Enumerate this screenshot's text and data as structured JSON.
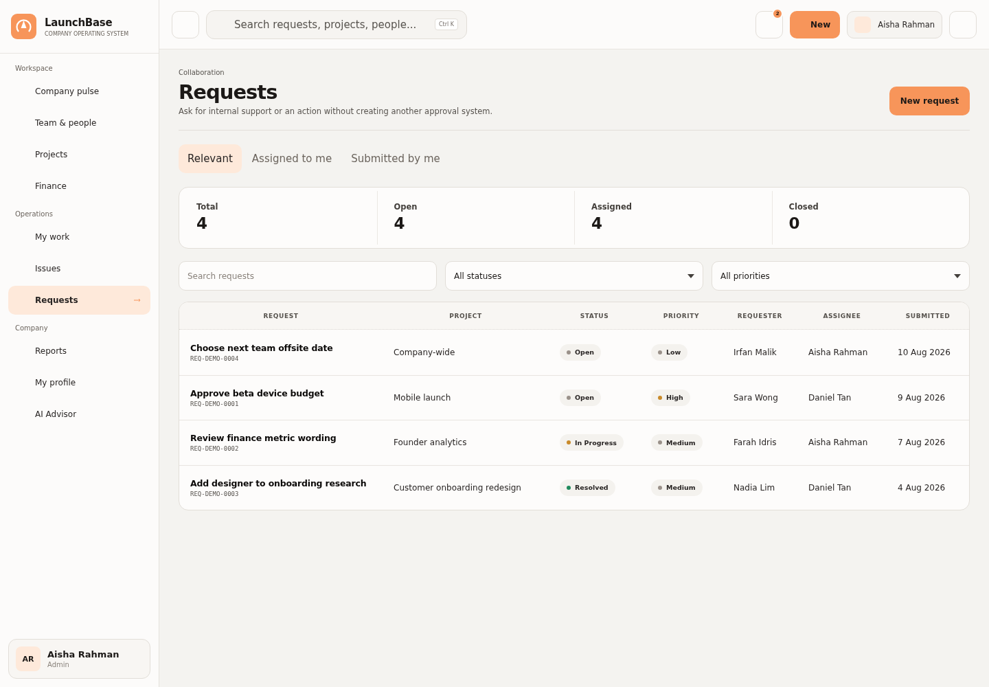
{
  "brand": {
    "name": "LaunchBase",
    "tagline": "COMPANY OPERATING SYSTEM"
  },
  "sidebar": {
    "sections": [
      {
        "title": "Workspace",
        "items": [
          {
            "label": "Company pulse",
            "selected": false
          },
          {
            "label": "Team & people",
            "selected": false
          },
          {
            "label": "Projects",
            "selected": false
          },
          {
            "label": "Finance",
            "selected": false
          }
        ]
      },
      {
        "title": "Operations",
        "items": [
          {
            "label": "My work",
            "selected": false
          },
          {
            "label": "Issues",
            "selected": false
          },
          {
            "label": "Requests",
            "selected": true
          }
        ]
      },
      {
        "title": "Company",
        "items": [
          {
            "label": "Reports",
            "selected": false
          },
          {
            "label": "My profile",
            "selected": false
          },
          {
            "label": "AI Advisor",
            "selected": false
          }
        ]
      }
    ],
    "user": {
      "initials": "AR",
      "name": "Aisha Rahman",
      "role": "Admin"
    }
  },
  "topbar": {
    "search_placeholder": "Search requests, projects, people...",
    "shortcut": "Ctrl K",
    "notification_count": "2",
    "new_button": "New",
    "user_name": "Aisha Rahman"
  },
  "page": {
    "breadcrumb": "Collaboration",
    "title": "Requests",
    "subtitle": "Ask for internal support or an action without creating another approval system.",
    "action": "New request"
  },
  "tabs": [
    {
      "label": "Relevant",
      "selected": true
    },
    {
      "label": "Assigned to me",
      "selected": false
    },
    {
      "label": "Submitted by me",
      "selected": false
    }
  ],
  "stats": [
    {
      "label": "Total",
      "value": "4"
    },
    {
      "label": "Open",
      "value": "4"
    },
    {
      "label": "Assigned",
      "value": "4"
    },
    {
      "label": "Closed",
      "value": "0"
    }
  ],
  "filters": {
    "search_placeholder": "Search requests",
    "status": "All statuses",
    "priority": "All priorities"
  },
  "table": {
    "columns": [
      "REQUEST",
      "PROJECT",
      "STATUS",
      "PRIORITY",
      "REQUESTER",
      "ASSIGNEE",
      "SUBMITTED"
    ],
    "rows": [
      {
        "title": "Choose next team offsite date",
        "id": "REQ-DEMO-0004",
        "project": "Company-wide",
        "status": {
          "label": "Open",
          "color": "#9a918a"
        },
        "priority": {
          "label": "Low",
          "color": "#9a918a"
        },
        "requester": "Irfan Malik",
        "assignee": "Aisha Rahman",
        "submitted": "10 Aug 2026"
      },
      {
        "title": "Approve beta device budget",
        "id": "REQ-DEMO-0001",
        "project": "Mobile launch",
        "status": {
          "label": "Open",
          "color": "#9a918a"
        },
        "priority": {
          "label": "High",
          "color": "#c98a2a"
        },
        "requester": "Sara Wong",
        "assignee": "Daniel Tan",
        "submitted": "9 Aug 2026"
      },
      {
        "title": "Review finance metric wording",
        "id": "REQ-DEMO-0002",
        "project": "Founder analytics",
        "status": {
          "label": "In Progress",
          "color": "#c98a2a"
        },
        "priority": {
          "label": "Medium",
          "color": "#9a918a"
        },
        "requester": "Farah Idris",
        "assignee": "Aisha Rahman",
        "submitted": "7 Aug 2026"
      },
      {
        "title": "Add designer to onboarding research",
        "id": "REQ-DEMO-0003",
        "project": "Customer onboarding redesign",
        "status": {
          "label": "Resolved",
          "color": "#1f8a5c"
        },
        "priority": {
          "label": "Medium",
          "color": "#9a918a"
        },
        "requester": "Nadia Lim",
        "assignee": "Daniel Tan",
        "submitted": "4 Aug 2026"
      }
    ]
  }
}
